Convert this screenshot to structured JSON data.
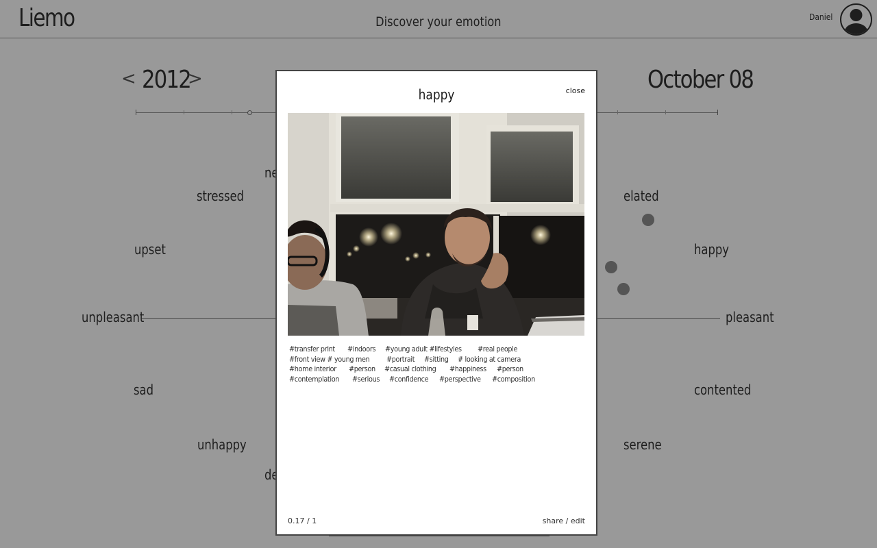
{
  "header": {
    "logo": "Liemo",
    "tagline": "Discover your emotion",
    "username": "Daniel"
  },
  "nav": {
    "prev": "<",
    "year": "2012",
    "next": ">",
    "date": "October 08"
  },
  "emotions": {
    "stressed": "stressed",
    "partial_top": "ne",
    "elated": "elated",
    "upset": "upset",
    "happy": "happy",
    "unpleasant": "unpleasant",
    "pleasant": "pleasant",
    "sad": "sad",
    "contented": "contented",
    "unhappy": "unhappy",
    "serene": "serene",
    "partial_bottom": "de"
  },
  "modal": {
    "title": "happy",
    "close_label": "close",
    "tags": [
      "#transfer print",
      "#indoors",
      "#young adult #lifestyles",
      "#real people",
      "#front view # young men",
      "#portrait",
      "#sitting",
      "# looking at camera",
      "#home interior",
      "#person",
      "#casual clothing",
      "#happiness",
      "#person",
      "#contemplation",
      "#serious",
      "#confidence",
      "#perspective",
      "#composition"
    ],
    "score": "0.17 / 1",
    "share_edit": "share / edit"
  },
  "colors": {
    "background": "#999999",
    "modal": "#ffffff",
    "text": "#1e1e1e",
    "dot": "#555555"
  }
}
